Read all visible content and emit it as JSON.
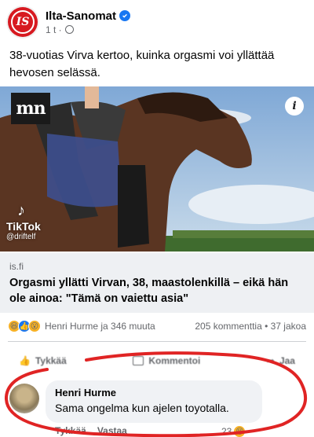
{
  "page": {
    "name": "Ilta-Sanomat",
    "logo_text": "IS",
    "time": "1 t",
    "verified_icon": "verified-check-icon",
    "globe_icon": "globe-icon"
  },
  "post": {
    "text": "38-vuotias Virva kertoo, kuinka orgasmi voi yllättää hevosen selässä."
  },
  "media": {
    "badge": "mn",
    "info": "i",
    "tiktok_label": "TikTok",
    "tiktok_handle": "@driftelf"
  },
  "link": {
    "domain": "is.fi",
    "title": "Orgasmi yllätti Virvan, 38, maastolenkillä – eikä hän ole ainoa: \"Tämä on vaiettu asia\""
  },
  "reactions": {
    "summary": "Henri Hurme ja 346 muuta",
    "comments": "205 kommenttia",
    "shares": "37 jakoa",
    "icons": [
      "haha-icon",
      "like-icon",
      "wow-icon"
    ]
  },
  "actions": {
    "like": "Tykkää",
    "comment": "Kommentoi",
    "share": "Jaa"
  },
  "comment": {
    "author": "Henri Hurme",
    "text": "Sama ongelma kun ajelen toyotalla.",
    "like": "Tykkää",
    "reply": "Vastaa",
    "count": "23"
  },
  "colors": {
    "brand_red": "#d71920",
    "facebook_blue": "#1877f2",
    "annotation_red": "#e02424"
  }
}
